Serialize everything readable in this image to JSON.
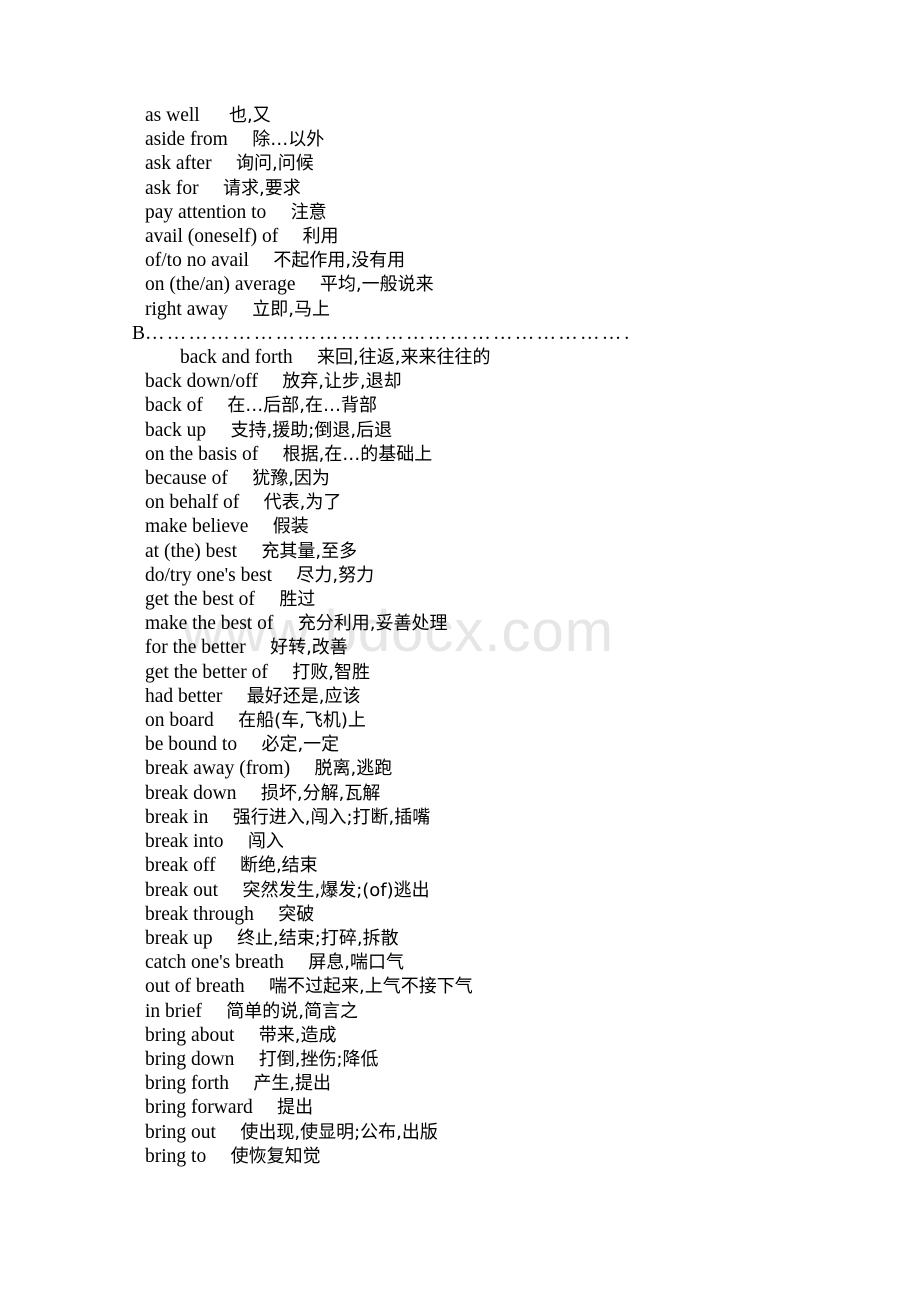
{
  "document": {
    "watermark": "www.bdocx.com",
    "sections": [
      {
        "id": "section-a-tail",
        "heading": null,
        "entries": [
          {
            "en": "as well",
            "gap": "      ",
            "cn": "也,又",
            "indent": false
          },
          {
            "en": "aside from",
            "gap": "     ",
            "cn": "除…以外",
            "indent": false
          },
          {
            "en": "ask after",
            "gap": "     ",
            "cn": "询问,问候",
            "indent": false
          },
          {
            "en": "ask for",
            "gap": "     ",
            "cn": "请求,要求",
            "indent": false
          },
          {
            "en": "pay attention to",
            "gap": "     ",
            "cn": "注意",
            "indent": false
          },
          {
            "en": "avail (oneself) of",
            "gap": "     ",
            "cn": "利用",
            "indent": false
          },
          {
            "en": "of/to no avail",
            "gap": "     ",
            "cn": "不起作用,没有用",
            "indent": false
          },
          {
            "en": "on (the/an) average",
            "gap": "     ",
            "cn": "平均,一般说来",
            "indent": false
          },
          {
            "en": "right away",
            "gap": "     ",
            "cn": "立即,马上",
            "indent": false
          }
        ]
      },
      {
        "id": "section-b",
        "heading": {
          "letter": "B",
          "leader": "…………………………………………………………………………."
        },
        "entries": [
          {
            "en": "back and forth",
            "gap": "     ",
            "cn": "来回,往返,来来往往的",
            "indent": true
          },
          {
            "en": "back down/off",
            "gap": "     ",
            "cn": "放弃,让步,退却",
            "indent": false
          },
          {
            "en": "back of",
            "gap": "     ",
            "cn": "在…后部,在…背部",
            "indent": false
          },
          {
            "en": "back up",
            "gap": "     ",
            "cn": "支持,援助;倒退,后退",
            "indent": false
          },
          {
            "en": "on the basis of",
            "gap": "     ",
            "cn": "根据,在…的基础上",
            "indent": false
          },
          {
            "en": "because of",
            "gap": "     ",
            "cn": "犹豫,因为",
            "indent": false
          },
          {
            "en": "on behalf of",
            "gap": "     ",
            "cn": "代表,为了",
            "indent": false
          },
          {
            "en": "make believe",
            "gap": "     ",
            "cn": "假装",
            "indent": false
          },
          {
            "en": "at (the) best",
            "gap": "     ",
            "cn": "充其量,至多",
            "indent": false
          },
          {
            "en": "do/try one's best",
            "gap": "     ",
            "cn": "尽力,努力",
            "indent": false
          },
          {
            "en": "get the best of",
            "gap": "     ",
            "cn": "胜过",
            "indent": false
          },
          {
            "en": "make the best of",
            "gap": "     ",
            "cn": "充分利用,妥善处理",
            "indent": false
          },
          {
            "en": "for the better",
            "gap": "     ",
            "cn": "好转,改善",
            "indent": false
          },
          {
            "en": "get the better of",
            "gap": "     ",
            "cn": "打败,智胜",
            "indent": false
          },
          {
            "en": "had better",
            "gap": "     ",
            "cn": "最好还是,应该",
            "indent": false
          },
          {
            "en": "on board",
            "gap": "     ",
            "cn": "在船(车,飞机)上",
            "indent": false
          },
          {
            "en": "be bound to",
            "gap": "     ",
            "cn": "必定,一定",
            "indent": false
          },
          {
            "en": "break away (from)",
            "gap": "     ",
            "cn": "脱离,逃跑",
            "indent": false
          },
          {
            "en": "break down",
            "gap": "     ",
            "cn": "损坏,分解,瓦解",
            "indent": false
          },
          {
            "en": "break in",
            "gap": "     ",
            "cn": "强行进入,闯入;打断,插嘴",
            "indent": false
          },
          {
            "en": "break into",
            "gap": "     ",
            "cn": "闯入",
            "indent": false
          },
          {
            "en": "break off",
            "gap": "     ",
            "cn": "断绝,结束",
            "indent": false
          },
          {
            "en": "break out",
            "gap": "     ",
            "cn": "突然发生,爆发;(of)逃出",
            "indent": false
          },
          {
            "en": "break through",
            "gap": "     ",
            "cn": "突破",
            "indent": false
          },
          {
            "en": "break up",
            "gap": "     ",
            "cn": "终止,结束;打碎,拆散",
            "indent": false
          },
          {
            "en": "catch one's breath",
            "gap": "     ",
            "cn": "屏息,喘口气",
            "indent": false
          },
          {
            "en": "out of breath",
            "gap": "     ",
            "cn": "喘不过起来,上气不接下气",
            "indent": false
          },
          {
            "en": "in brief",
            "gap": "     ",
            "cn": "简单的说,简言之",
            "indent": false
          },
          {
            "en": "bring about",
            "gap": "     ",
            "cn": "带来,造成",
            "indent": false
          },
          {
            "en": "bring down",
            "gap": "     ",
            "cn": "打倒,挫伤;降低",
            "indent": false
          },
          {
            "en": "bring forth",
            "gap": "     ",
            "cn": "产生,提出",
            "indent": false
          },
          {
            "en": "bring forward",
            "gap": "     ",
            "cn": "提出",
            "indent": false
          },
          {
            "en": "bring out",
            "gap": "     ",
            "cn": "使出现,使显明;公布,出版",
            "indent": false
          },
          {
            "en": "bring to",
            "gap": "     ",
            "cn": "使恢复知觉",
            "indent": false
          }
        ]
      }
    ]
  }
}
